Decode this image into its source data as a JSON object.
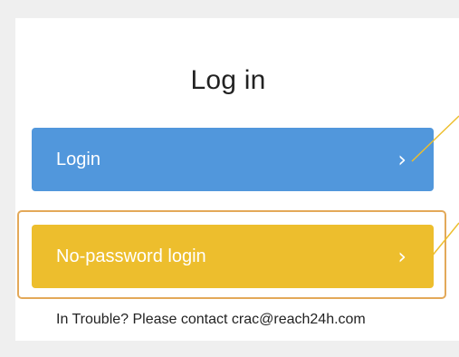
{
  "dialog": {
    "title": "Log in"
  },
  "buttons": {
    "login_label": "Login",
    "no_password_label": "No-password login",
    "chevron": "›"
  },
  "footer": {
    "text": "In Trouble? Please contact crac@reach24h.com"
  },
  "colors": {
    "login_button": "#5197dc",
    "no_password_button": "#edbe2d",
    "highlight_border": "#e3a959",
    "callout_line": "#edbe2d"
  }
}
